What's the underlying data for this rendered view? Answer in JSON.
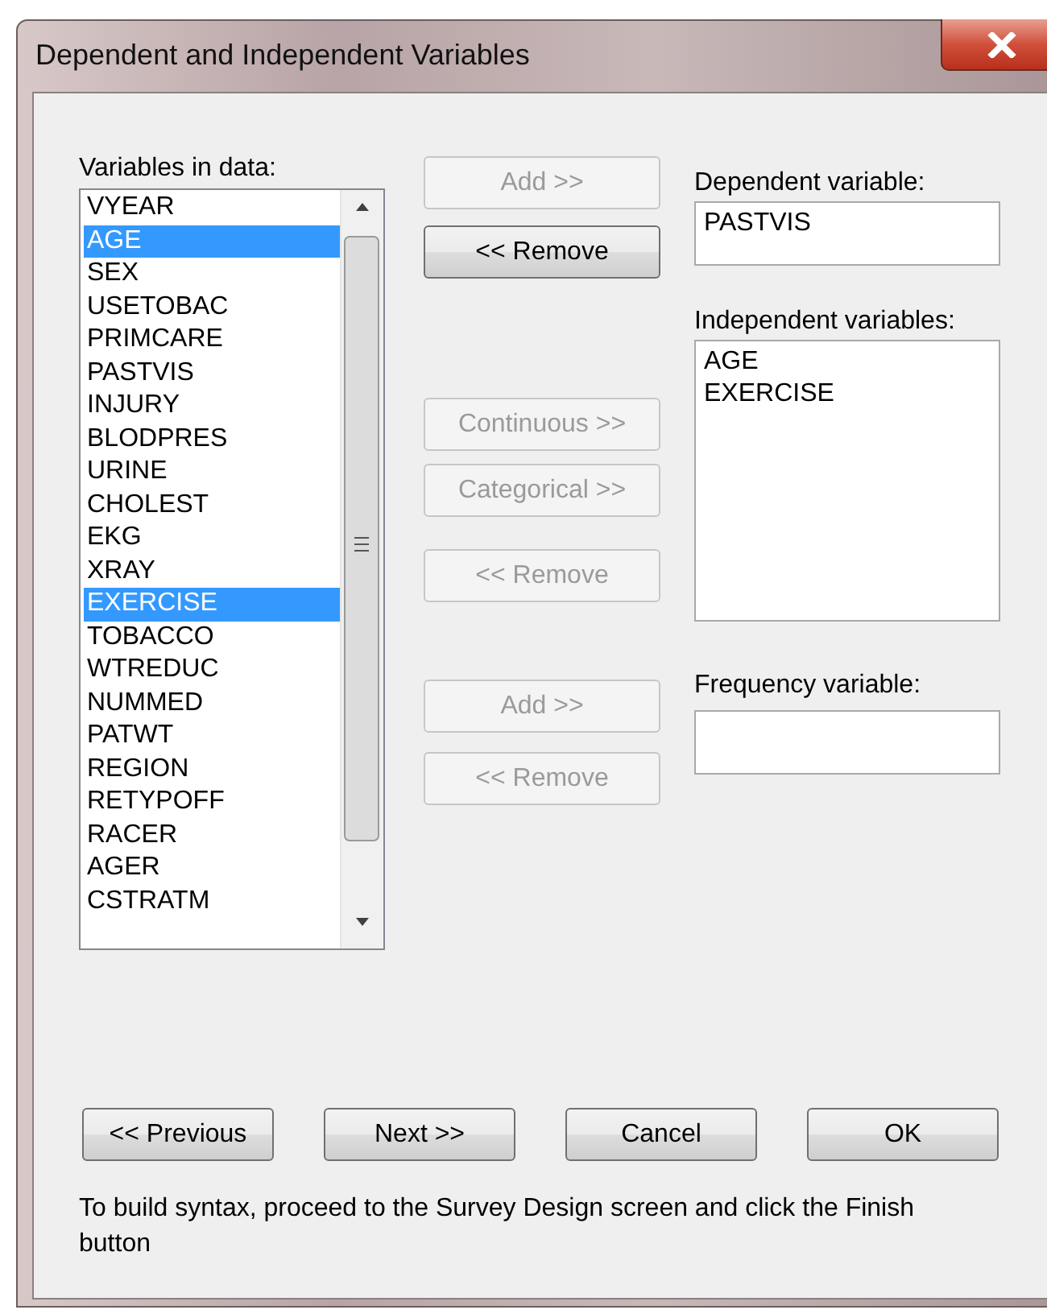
{
  "window": {
    "title": "Dependent and Independent Variables"
  },
  "variables_label": "Variables in data:",
  "variables": [
    {
      "name": "VYEAR",
      "selected": false
    },
    {
      "name": "AGE",
      "selected": true
    },
    {
      "name": "SEX",
      "selected": false
    },
    {
      "name": "USETOBAC",
      "selected": false
    },
    {
      "name": "PRIMCARE",
      "selected": false
    },
    {
      "name": "PASTVIS",
      "selected": false
    },
    {
      "name": "INJURY",
      "selected": false
    },
    {
      "name": "BLODPRES",
      "selected": false
    },
    {
      "name": "URINE",
      "selected": false
    },
    {
      "name": "CHOLEST",
      "selected": false
    },
    {
      "name": "EKG",
      "selected": false
    },
    {
      "name": "XRAY",
      "selected": false
    },
    {
      "name": "EXERCISE",
      "selected": true
    },
    {
      "name": "TOBACCO",
      "selected": false
    },
    {
      "name": "WTREDUC",
      "selected": false
    },
    {
      "name": "NUMMED",
      "selected": false
    },
    {
      "name": "PATWT",
      "selected": false
    },
    {
      "name": "REGION",
      "selected": false
    },
    {
      "name": "RETYPOFF",
      "selected": false
    },
    {
      "name": "RACER",
      "selected": false
    },
    {
      "name": "AGER",
      "selected": false
    },
    {
      "name": "CSTRATM",
      "selected": false
    }
  ],
  "dependent_buttons": [
    {
      "label": "Add >>",
      "disabled": true
    },
    {
      "label": "<< Remove",
      "disabled": false
    }
  ],
  "independent_buttons": [
    {
      "label": "Continuous >>",
      "disabled": true
    },
    {
      "label": "Categorical >>",
      "disabled": true
    },
    {
      "label": "<< Remove",
      "disabled": true
    }
  ],
  "frequency_buttons": [
    {
      "label": "Add >>",
      "disabled": true
    },
    {
      "label": "<< Remove",
      "disabled": true
    }
  ],
  "dependent": {
    "label": "Dependent variable:",
    "value": "PASTVIS"
  },
  "independent": {
    "label": "Independent variables:",
    "items": [
      "AGE",
      "EXERCISE"
    ]
  },
  "frequency": {
    "label": "Frequency variable:"
  },
  "footer_buttons": [
    {
      "label": "<< Previous"
    },
    {
      "label": "Next >>"
    },
    {
      "label": "Cancel"
    },
    {
      "label": "OK"
    }
  ],
  "note": "To build  syntax, proceed to the Survey Design screen and click the Finish button"
}
